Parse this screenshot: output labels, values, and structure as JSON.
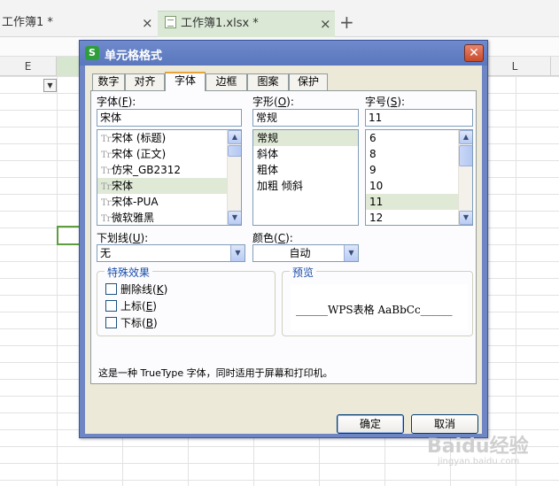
{
  "tabs": {
    "doc1": "工作簿1 *",
    "doc2": "工作簿1.xlsx *",
    "close_glyph": "×",
    "new_glyph": "+"
  },
  "sheet": {
    "col_e": "E",
    "col_l": "L"
  },
  "dialog": {
    "icon_letter": "S",
    "title": "单元格格式",
    "close_glyph": "✕",
    "tabs": [
      "数字",
      "对齐",
      "字体",
      "边框",
      "图案",
      "保护"
    ],
    "active_tab": "字体",
    "font": {
      "label": "字体",
      "hotkey": "F",
      "value": "宋体",
      "items": [
        "宋体 (标题)",
        "宋体 (正文)",
        "仿宋_GB2312",
        "宋体",
        "宋体-PUA",
        "微软雅黑"
      ],
      "selected": "宋体"
    },
    "style": {
      "label": "字形",
      "hotkey": "O",
      "value": "常规",
      "items": [
        "常规",
        "斜体",
        "粗体",
        "加粗 倾斜"
      ],
      "selected": "常规"
    },
    "size": {
      "label": "字号",
      "hotkey": "S",
      "value": "11",
      "items": [
        "6",
        "8",
        "9",
        "10",
        "11",
        "12"
      ],
      "selected": "11"
    },
    "underline": {
      "label": "下划线",
      "hotkey": "U",
      "value": "无"
    },
    "color": {
      "label": "颜色",
      "hotkey": "C",
      "value": "自动"
    },
    "effects": {
      "legend": "特殊效果",
      "strikethrough": {
        "label": "删除线",
        "hotkey": "K",
        "checked": false
      },
      "superscript": {
        "label": "上标",
        "hotkey": "E",
        "checked": false
      },
      "subscript": {
        "label": "下标",
        "hotkey": "B",
        "checked": false
      }
    },
    "preview": {
      "legend": "预览",
      "text": "______WPS表格  AaBbCc______"
    },
    "info": "这是一种 TrueType 字体，同时适用于屏幕和打印机。",
    "ok_label": "确定",
    "cancel_label": "取消"
  },
  "watermark": {
    "text": "Baidu经验",
    "sub": "jingyan.baidu.com"
  }
}
